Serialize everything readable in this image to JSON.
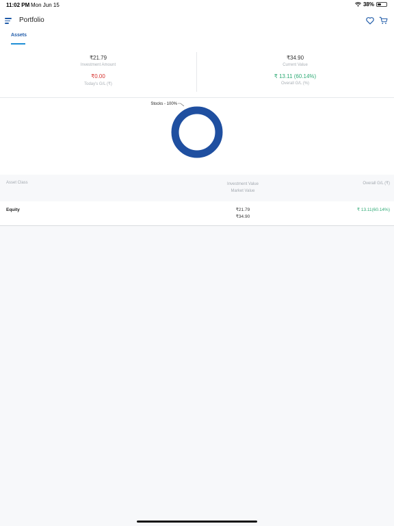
{
  "status_bar": {
    "time": "11:02 PM",
    "date": "Mon Jun 15",
    "battery": "38%"
  },
  "header": {
    "title": "Portfolio"
  },
  "tabs": [
    {
      "label": "Assets",
      "active": true
    }
  ],
  "summary": {
    "investment_amount": {
      "value": "₹21.79",
      "label": "Investment Amount"
    },
    "current_value": {
      "value": "₹34.90",
      "label": "Current Value"
    },
    "todays_gl": {
      "value": "₹0.00",
      "label": "Today's G/L (₹)"
    },
    "overall_gl": {
      "value": "₹ 13.11 (60.14%)",
      "label": "Overall G/L (%)"
    }
  },
  "chart_data": {
    "type": "pie",
    "variant": "donut",
    "categories": [
      "Stocks"
    ],
    "values": [
      100
    ],
    "labels": [
      "Stocks - 100%"
    ],
    "colors": [
      "#1f4fa0"
    ]
  },
  "table": {
    "headers": {
      "asset_class": "Asset Class",
      "investment_value": "Investment Value",
      "market_value": "Market Value",
      "overall_gl": "Overall G/L (₹)"
    },
    "rows": [
      {
        "asset_class": "Equity",
        "investment_value": "₹21.79",
        "market_value": "₹34.90",
        "overall_gl": "₹ 13.11(60.14%)"
      }
    ]
  },
  "colors": {
    "accent": "#1e5aa8",
    "positive": "#2eaa75",
    "negative": "#d6322f",
    "donut": "#1f4fa0"
  }
}
